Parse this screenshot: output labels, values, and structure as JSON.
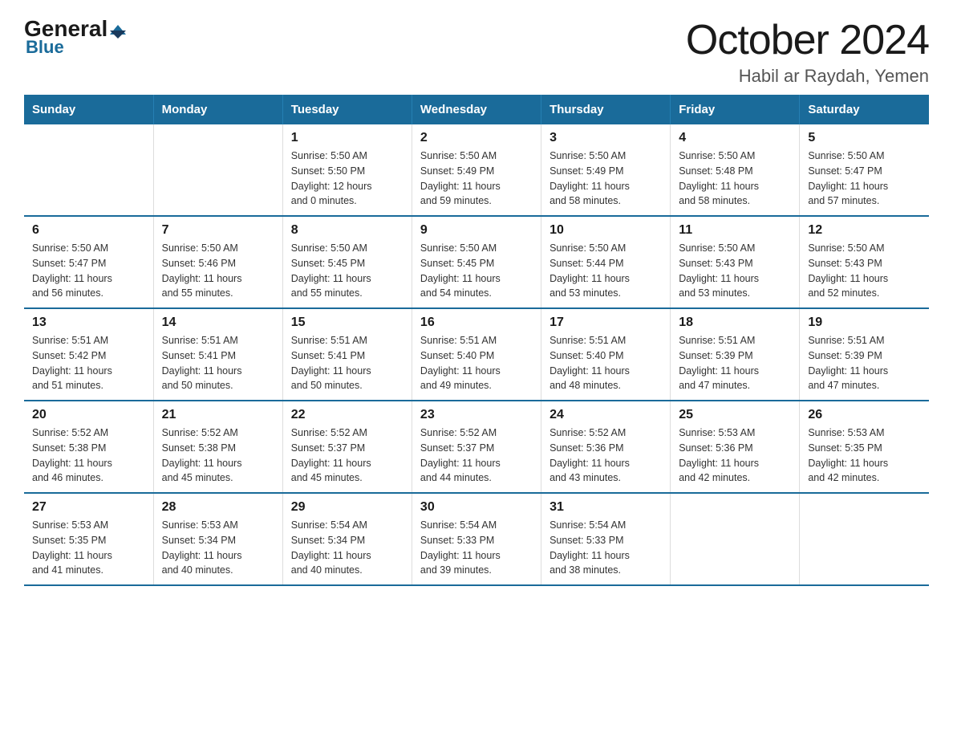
{
  "header": {
    "title": "October 2024",
    "subtitle": "Habil ar Raydah, Yemen",
    "logo_general": "General",
    "logo_blue": "Blue"
  },
  "days_of_week": [
    "Sunday",
    "Monday",
    "Tuesday",
    "Wednesday",
    "Thursday",
    "Friday",
    "Saturday"
  ],
  "weeks": [
    [
      {
        "day": "",
        "info": ""
      },
      {
        "day": "",
        "info": ""
      },
      {
        "day": "1",
        "info": "Sunrise: 5:50 AM\nSunset: 5:50 PM\nDaylight: 12 hours\nand 0 minutes."
      },
      {
        "day": "2",
        "info": "Sunrise: 5:50 AM\nSunset: 5:49 PM\nDaylight: 11 hours\nand 59 minutes."
      },
      {
        "day": "3",
        "info": "Sunrise: 5:50 AM\nSunset: 5:49 PM\nDaylight: 11 hours\nand 58 minutes."
      },
      {
        "day": "4",
        "info": "Sunrise: 5:50 AM\nSunset: 5:48 PM\nDaylight: 11 hours\nand 58 minutes."
      },
      {
        "day": "5",
        "info": "Sunrise: 5:50 AM\nSunset: 5:47 PM\nDaylight: 11 hours\nand 57 minutes."
      }
    ],
    [
      {
        "day": "6",
        "info": "Sunrise: 5:50 AM\nSunset: 5:47 PM\nDaylight: 11 hours\nand 56 minutes."
      },
      {
        "day": "7",
        "info": "Sunrise: 5:50 AM\nSunset: 5:46 PM\nDaylight: 11 hours\nand 55 minutes."
      },
      {
        "day": "8",
        "info": "Sunrise: 5:50 AM\nSunset: 5:45 PM\nDaylight: 11 hours\nand 55 minutes."
      },
      {
        "day": "9",
        "info": "Sunrise: 5:50 AM\nSunset: 5:45 PM\nDaylight: 11 hours\nand 54 minutes."
      },
      {
        "day": "10",
        "info": "Sunrise: 5:50 AM\nSunset: 5:44 PM\nDaylight: 11 hours\nand 53 minutes."
      },
      {
        "day": "11",
        "info": "Sunrise: 5:50 AM\nSunset: 5:43 PM\nDaylight: 11 hours\nand 53 minutes."
      },
      {
        "day": "12",
        "info": "Sunrise: 5:50 AM\nSunset: 5:43 PM\nDaylight: 11 hours\nand 52 minutes."
      }
    ],
    [
      {
        "day": "13",
        "info": "Sunrise: 5:51 AM\nSunset: 5:42 PM\nDaylight: 11 hours\nand 51 minutes."
      },
      {
        "day": "14",
        "info": "Sunrise: 5:51 AM\nSunset: 5:41 PM\nDaylight: 11 hours\nand 50 minutes."
      },
      {
        "day": "15",
        "info": "Sunrise: 5:51 AM\nSunset: 5:41 PM\nDaylight: 11 hours\nand 50 minutes."
      },
      {
        "day": "16",
        "info": "Sunrise: 5:51 AM\nSunset: 5:40 PM\nDaylight: 11 hours\nand 49 minutes."
      },
      {
        "day": "17",
        "info": "Sunrise: 5:51 AM\nSunset: 5:40 PM\nDaylight: 11 hours\nand 48 minutes."
      },
      {
        "day": "18",
        "info": "Sunrise: 5:51 AM\nSunset: 5:39 PM\nDaylight: 11 hours\nand 47 minutes."
      },
      {
        "day": "19",
        "info": "Sunrise: 5:51 AM\nSunset: 5:39 PM\nDaylight: 11 hours\nand 47 minutes."
      }
    ],
    [
      {
        "day": "20",
        "info": "Sunrise: 5:52 AM\nSunset: 5:38 PM\nDaylight: 11 hours\nand 46 minutes."
      },
      {
        "day": "21",
        "info": "Sunrise: 5:52 AM\nSunset: 5:38 PM\nDaylight: 11 hours\nand 45 minutes."
      },
      {
        "day": "22",
        "info": "Sunrise: 5:52 AM\nSunset: 5:37 PM\nDaylight: 11 hours\nand 45 minutes."
      },
      {
        "day": "23",
        "info": "Sunrise: 5:52 AM\nSunset: 5:37 PM\nDaylight: 11 hours\nand 44 minutes."
      },
      {
        "day": "24",
        "info": "Sunrise: 5:52 AM\nSunset: 5:36 PM\nDaylight: 11 hours\nand 43 minutes."
      },
      {
        "day": "25",
        "info": "Sunrise: 5:53 AM\nSunset: 5:36 PM\nDaylight: 11 hours\nand 42 minutes."
      },
      {
        "day": "26",
        "info": "Sunrise: 5:53 AM\nSunset: 5:35 PM\nDaylight: 11 hours\nand 42 minutes."
      }
    ],
    [
      {
        "day": "27",
        "info": "Sunrise: 5:53 AM\nSunset: 5:35 PM\nDaylight: 11 hours\nand 41 minutes."
      },
      {
        "day": "28",
        "info": "Sunrise: 5:53 AM\nSunset: 5:34 PM\nDaylight: 11 hours\nand 40 minutes."
      },
      {
        "day": "29",
        "info": "Sunrise: 5:54 AM\nSunset: 5:34 PM\nDaylight: 11 hours\nand 40 minutes."
      },
      {
        "day": "30",
        "info": "Sunrise: 5:54 AM\nSunset: 5:33 PM\nDaylight: 11 hours\nand 39 minutes."
      },
      {
        "day": "31",
        "info": "Sunrise: 5:54 AM\nSunset: 5:33 PM\nDaylight: 11 hours\nand 38 minutes."
      },
      {
        "day": "",
        "info": ""
      },
      {
        "day": "",
        "info": ""
      }
    ]
  ]
}
